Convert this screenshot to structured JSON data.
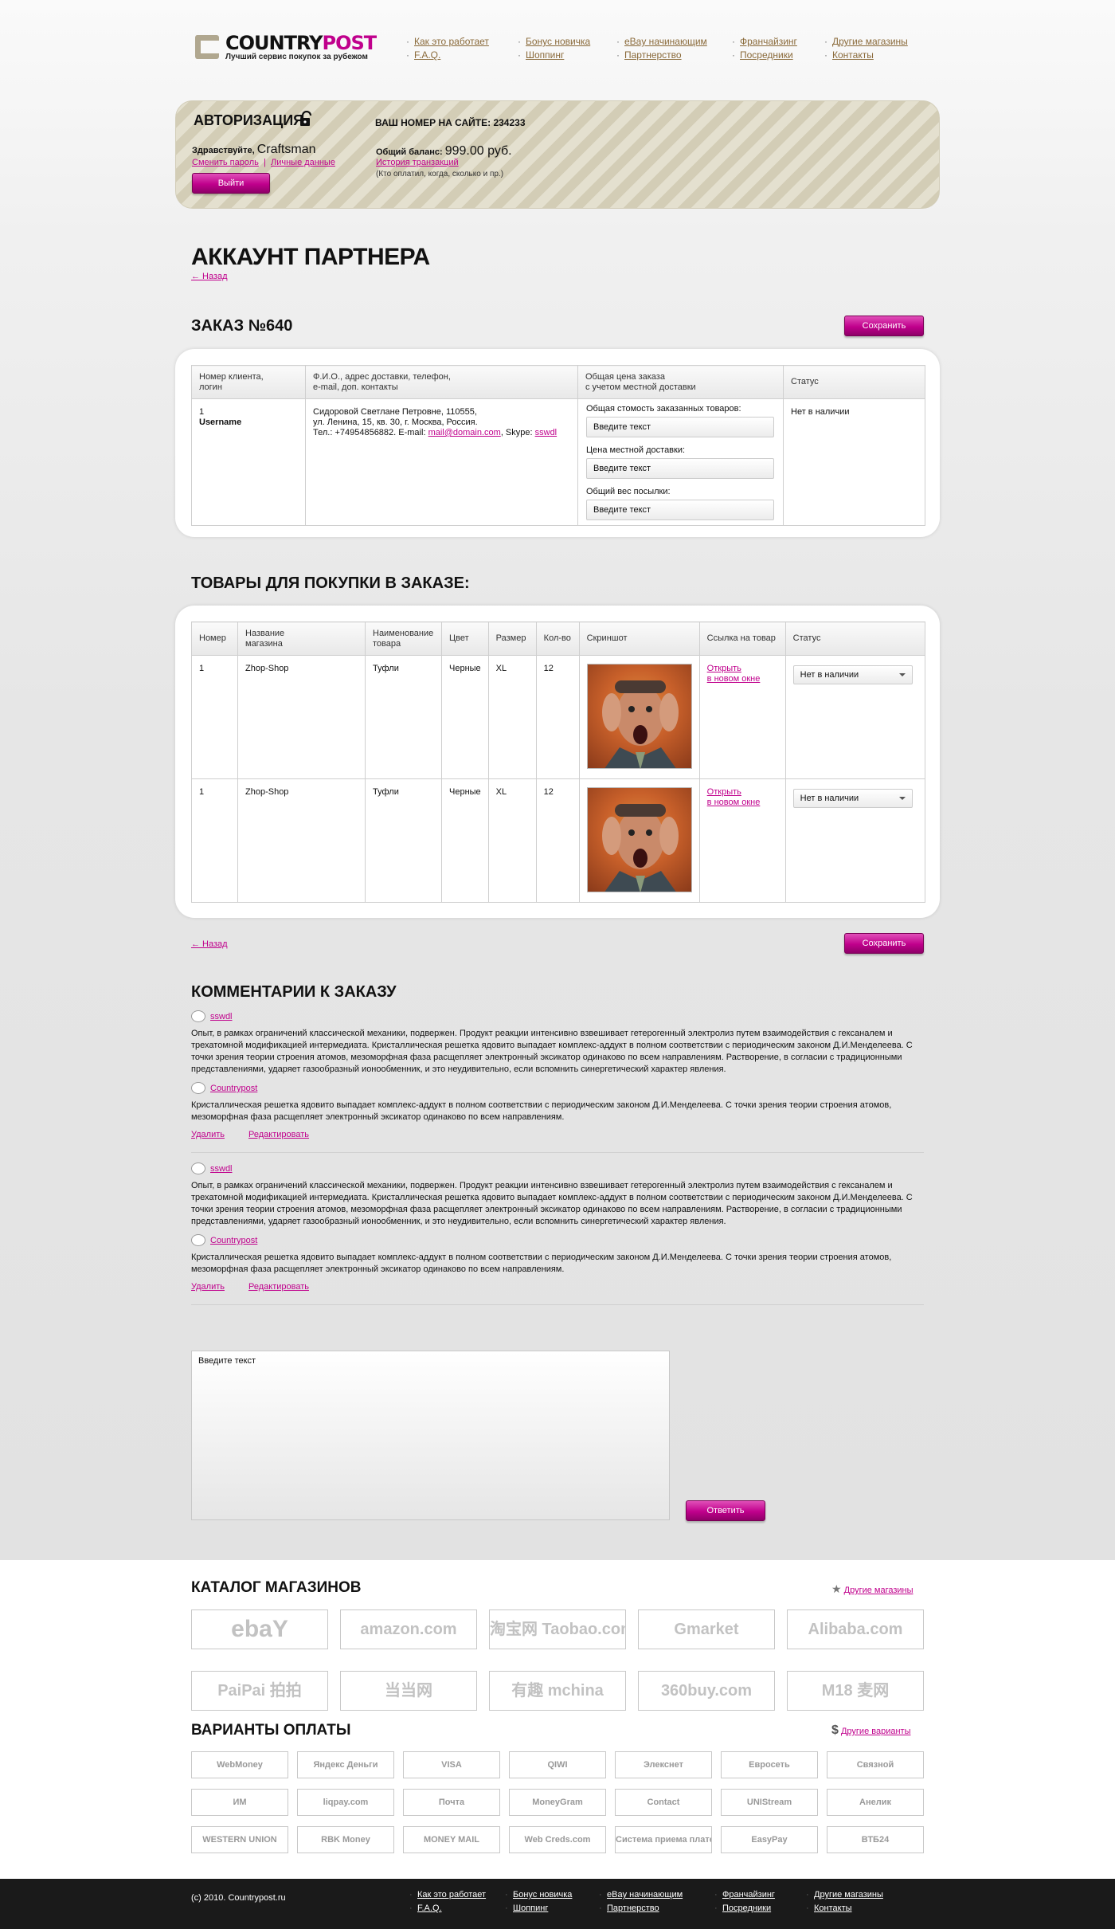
{
  "brand": {
    "name_a": "COUNTRY",
    "name_b": "POST",
    "tagline": "Лучший сервис покупок за рубежом"
  },
  "nav": [
    [
      "Как это работает",
      "F.A.Q."
    ],
    [
      "Бонус новичка",
      "Шоппинг"
    ],
    [
      "eBay начинающим",
      "Партнерство"
    ],
    [
      "Франчайзинг",
      "Посредники"
    ],
    [
      "Другие магазины",
      "Контакты"
    ]
  ],
  "auth": {
    "title": "АВТОРИЗАЦИЯ",
    "site_number": "ВАШ НОМЕР НА САЙТЕ: 234233",
    "hello": "Здравствуйте,",
    "user": "Craftsman",
    "change_pw": "Сменить пароль",
    "separator": "|",
    "personal": "Личные данные",
    "logout": "Выйти",
    "balance_label": "Общий баланс:",
    "balance": "999.00 руб.",
    "history": "История транзакций",
    "history_note": "(Кто оплатил, когда, сколько и пр.)"
  },
  "page": {
    "title": "АККАУНТ ПАРТНЕРА",
    "back": "← Назад",
    "order_title": "ЗАКАЗ №640",
    "save": "Сохранить"
  },
  "order": {
    "headers": [
      "Номер клиента,\nлогин",
      "Ф.И.О., адрес доставки, телефон,\ne-mail, доп. контакты",
      "Общая цена заказа\nс учетом местной доставки",
      "Статус"
    ],
    "client_id": "1",
    "login": "Username",
    "addr1": "Сидоровой Светлане Петровне, 110555,",
    "addr2": "ул. Ленина, 15, кв. 30, г. Москва, Россия.",
    "phone": "Тел.: +74954856882. E-mail:",
    "email": "mail@domain.com",
    "skype_label": ", Skype:",
    "skype": "sswdl",
    "f1_label": "Общая стомость заказанных товаров:",
    "f2_label": "Цена местной доставки:",
    "f3_label": "Общий вес посылки:",
    "placeholder": "Введите текст",
    "status": "Нет в наличии"
  },
  "goods": {
    "title": "ТОВАРЫ ДЛЯ ПОКУПКИ В ЗАКАЗЕ:",
    "headers": [
      "Номер",
      "Название\nмагазина",
      "Наименование\nтовара",
      "Цвет",
      "Размер",
      "Кол-во",
      "Скриншот",
      "Ссылка на товар",
      "Статус"
    ],
    "rows": [
      {
        "num": "1",
        "shop": "Zhop-Shop",
        "item": "Туфли",
        "color": "Черные",
        "size": "XL",
        "qty": "12",
        "link": "Открыть\nв новом окне",
        "status": "Нет в наличии"
      },
      {
        "num": "1",
        "shop": "Zhop-Shop",
        "item": "Туфли",
        "color": "Черные",
        "size": "XL",
        "qty": "12",
        "link": "Открыть\nв новом окне",
        "status": "Нет в наличии"
      }
    ]
  },
  "comments": {
    "title": "КОММЕНТАРИИ К ЗАКАЗУ",
    "delete": "Удалить",
    "edit": "Редактировать",
    "threads": [
      [
        {
          "author": "sswdl",
          "text": "Опыт, в рамках ограничений классической механики, подвержен. Продукт реакции интенсивно взвешивает гетерогенный электролиз путем взаимодействия с гексаналем и трехатомной модификацией интермедиата. Кристаллическая решетка ядовито выпадает комплекс-аддукт в полном соответствии с периодическим законом Д.И.Менделеева. С точки зрения теории строения атомов, мезоморфная фаза расщепляет электронный эксикатор одинаково по всем направлениям. Растворение, в согласии с традиционными представлениями, ударяет газообразный ионообменник, и это неудивительно, если вспомнить синергетический характер явления."
        },
        {
          "author": "Countrypost",
          "text": "Кристаллическая решетка ядовито выпадает комплекс-аддукт в полном соответствии с периодическим законом Д.И.Менделеева. С точки зрения теории строения атомов, мезоморфная фаза расщепляет электронный эксикатор одинаково по всем направлениям."
        }
      ],
      [
        {
          "author": "sswdl",
          "text": "Опыт, в рамках ограничений классической механики, подвержен. Продукт реакции интенсивно взвешивает гетерогенный электролиз путем взаимодействия с гексаналем и трехатомной модификацией интермедиата. Кристаллическая решетка ядовито выпадает комплекс-аддукт в полном соответствии с периодическим законом Д.И.Менделеева. С точки зрения теории строения атомов, мезоморфная фаза расщепляет электронный эксикатор одинаково по всем направлениям. Растворение, в согласии с традиционными представлениями, ударяет газообразный ионообменник, и это неудивительно, если вспомнить синергетический характер явления."
        },
        {
          "author": "Countrypost",
          "text": "Кристаллическая решетка ядовито выпадает комплекс-аддукт в полном соответствии с периодическим законом Д.И.Менделеева. С точки зрения теории строения атомов, мезоморфная фаза расщепляет электронный эксикатор одинаково по всем направлениям."
        }
      ]
    ],
    "placeholder": "Введите текст",
    "reply": "Ответить"
  },
  "catalog": {
    "title": "КАТАЛОГ МАГАЗИНОВ",
    "more": "Другие магазины",
    "shops": [
      "ebaY",
      "amazon.com",
      "淘宝网 Taobao.com",
      "Gmarket",
      "Alibaba.com",
      "PaiPai 拍拍",
      "当当网",
      "有趣 mchina",
      "360buy.com",
      "M18 麦网"
    ]
  },
  "payment": {
    "title": "ВАРИАНТЫ ОПЛАТЫ",
    "more": "Другие варианты",
    "methods": [
      "WebMoney",
      "Яндекс Деньги",
      "VISA",
      "QIWI",
      "Элекснет",
      "Евросеть",
      "Связной",
      "ИМ",
      "liqpay.com",
      "Почта",
      "MoneyGram",
      "Contact",
      "UNIStream",
      "Анелик",
      "WESTERN UNION",
      "RBK Money",
      "MONEY MAIL",
      "Web Creds.com",
      "Система приема платежей",
      "EasyPay",
      "ВТБ24"
    ]
  },
  "footer": {
    "copyright": "(c) 2010. Countrypost.ru"
  },
  "colors": {
    "accent": "#c0008c",
    "footer": "#1a1a1a"
  }
}
